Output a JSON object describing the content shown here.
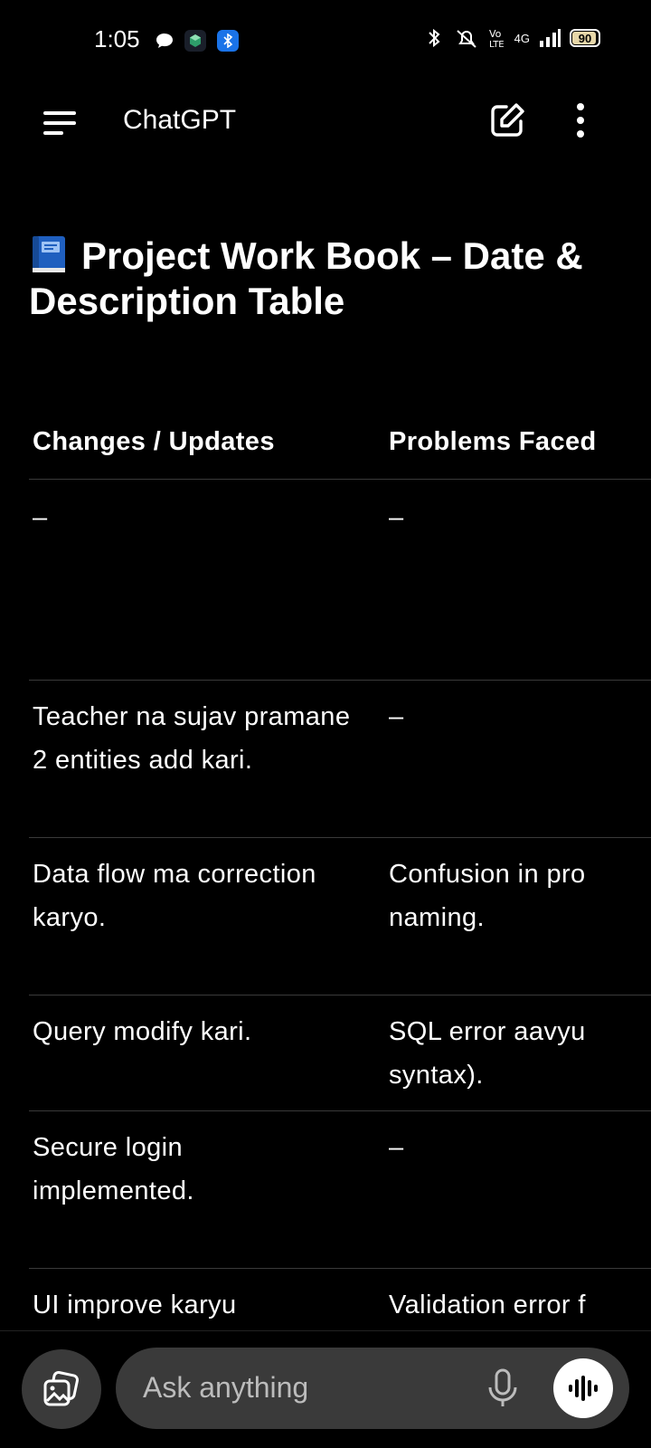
{
  "status_bar": {
    "time": "1:05",
    "network": "4G",
    "battery": "90"
  },
  "header": {
    "title": "ChatGPT"
  },
  "document": {
    "title": "Project Work Book – Date & Description Table"
  },
  "table": {
    "headers": [
      "Changes / Updates",
      "Problems Faced"
    ],
    "rows": [
      {
        "changes": "–",
        "problems": "–"
      },
      {
        "changes": "Teacher na sujav pramane 2 entities add kari.",
        "problems": "–"
      },
      {
        "changes": "Data flow ma correction karyo.",
        "problems": "Confusion in pro naming."
      },
      {
        "changes": "Query modify kari.",
        "problems": "SQL error aavyu syntax)."
      },
      {
        "changes": "Secure login implemented.",
        "problems": "–"
      },
      {
        "changes": "UI improve karyu",
        "problems": "Validation error f"
      }
    ]
  },
  "composer": {
    "placeholder": "Ask anything"
  }
}
